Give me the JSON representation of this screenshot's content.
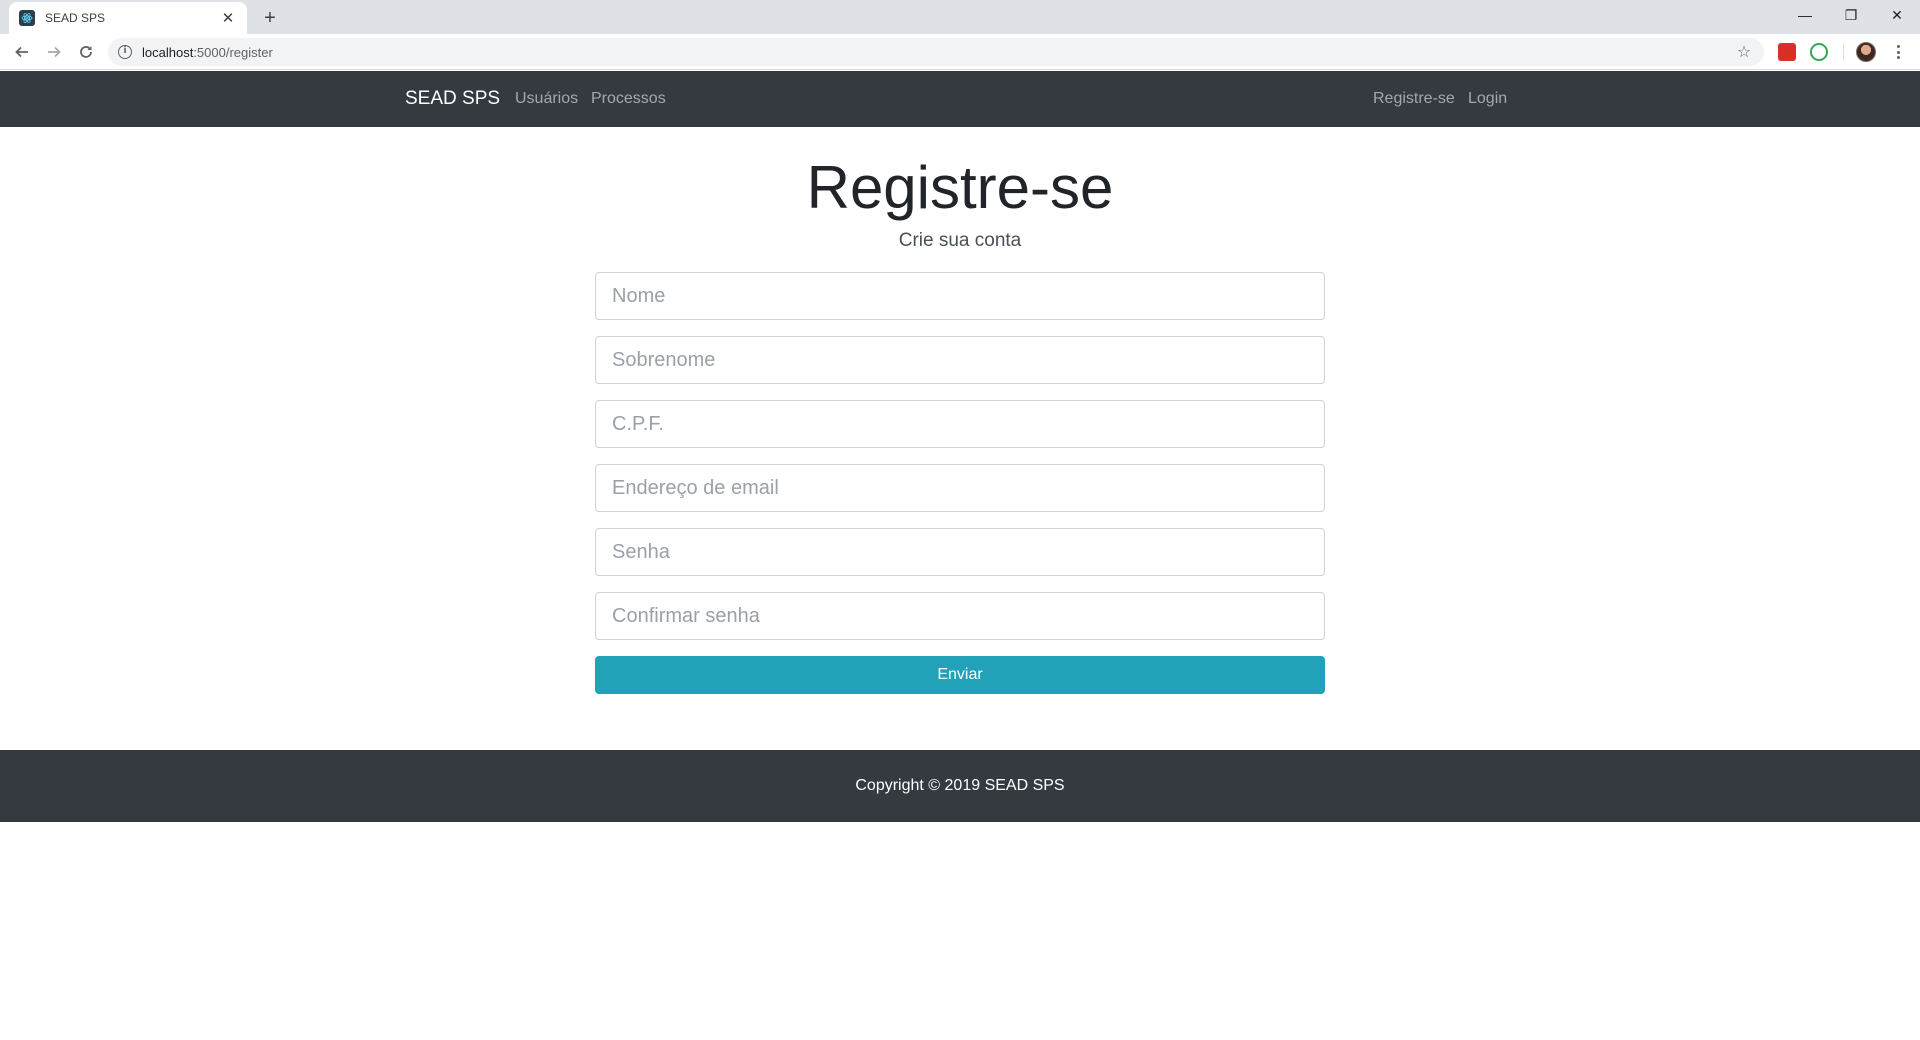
{
  "browser": {
    "tab_title": "SEAD SPS",
    "tab_close": "✕",
    "new_tab": "+",
    "url_host": "localhost",
    "url_path": ":5000/register",
    "window_controls": {
      "minimize": "—",
      "restore": "❐",
      "close": "✕"
    }
  },
  "navbar": {
    "brand": "SEAD SPS",
    "links_left": [
      "Usuários",
      "Processos"
    ],
    "links_right": [
      "Registre-se",
      "Login"
    ]
  },
  "page": {
    "title": "Registre-se",
    "subtitle": "Crie sua conta"
  },
  "form": {
    "fields": {
      "first_name": {
        "value": "",
        "placeholder": "Nome"
      },
      "last_name": {
        "value": "",
        "placeholder": "Sobrenome"
      },
      "cpf": {
        "value": "",
        "placeholder": "C.P.F."
      },
      "email": {
        "value": "",
        "placeholder": "Endereço de email"
      },
      "password": {
        "value": "",
        "placeholder": "Senha"
      },
      "confirm_password": {
        "value": "",
        "placeholder": "Confirmar senha"
      }
    },
    "submit_label": "Enviar"
  },
  "footer": {
    "text": "Copyright © 2019 SEAD SPS"
  },
  "colors": {
    "navbar_bg": "#343a40",
    "button_bg": "#21a2b8",
    "footer_bg": "#343a40"
  }
}
